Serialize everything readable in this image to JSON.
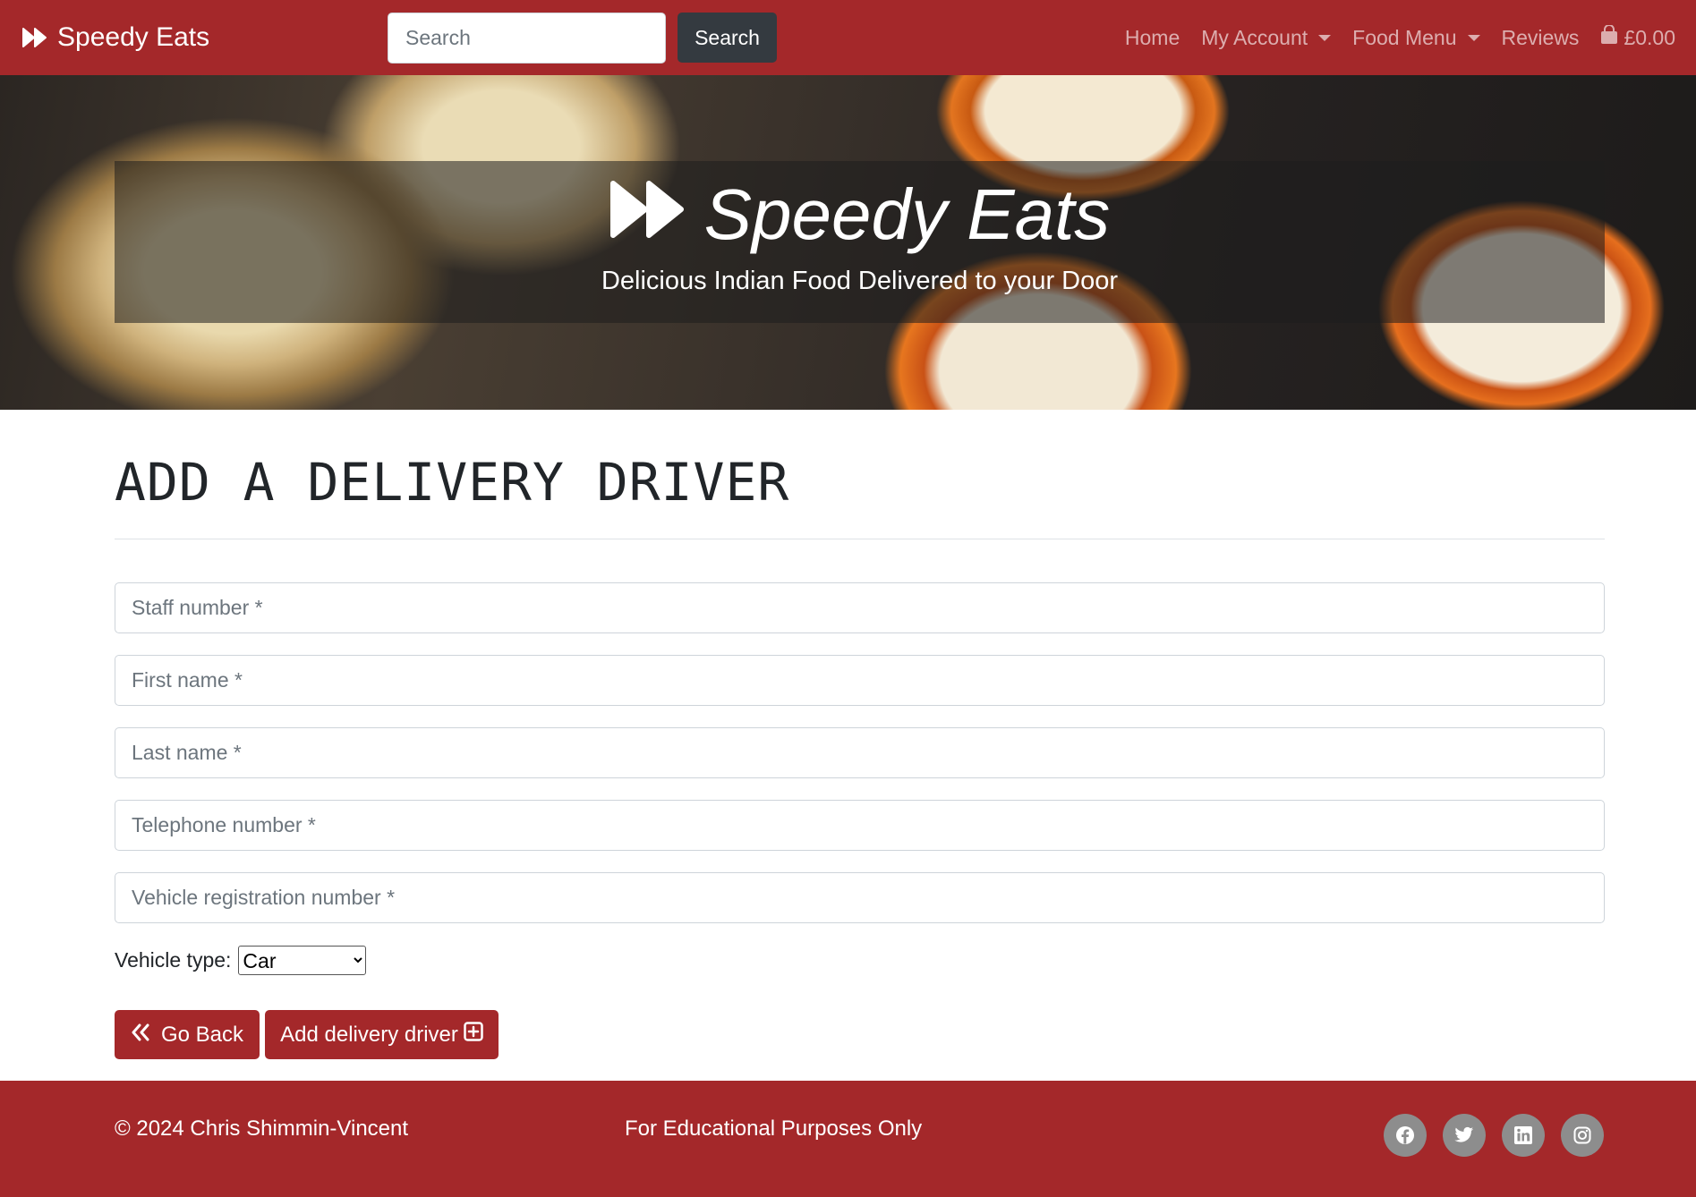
{
  "navbar": {
    "brand": "Speedy Eats",
    "search_placeholder": "Search",
    "search_button": "Search",
    "links": {
      "home": "Home",
      "my_account": "My Account",
      "food_menu": "Food Menu",
      "reviews": "Reviews",
      "basket_total": "£0.00"
    }
  },
  "hero": {
    "title": "Speedy Eats",
    "subtitle": "Delicious Indian Food Delivered to your Door"
  },
  "form": {
    "title": "ADD A DELIVERY DRIVER",
    "fields": {
      "staff_number": "Staff number *",
      "first_name": "First name *",
      "last_name": "Last name *",
      "telephone": "Telephone number *",
      "vehicle_registration": "Vehicle registration number *"
    },
    "vehicle_type_label": "Vehicle type:",
    "vehicle_type_selected": "Car",
    "go_back_button": "Go Back",
    "add_button": "Add delivery driver"
  },
  "footer": {
    "copyright": "© 2024 Chris Shimmin-Vincent",
    "disclaimer": "For Educational Purposes Only",
    "social_icons": [
      "facebook-icon",
      "twitter-icon",
      "linkedin-icon",
      "instagram-icon"
    ]
  },
  "colors": {
    "brand_red": "#a4282a",
    "dark_button": "#343a40",
    "social_grey": "#8d8d8d"
  }
}
